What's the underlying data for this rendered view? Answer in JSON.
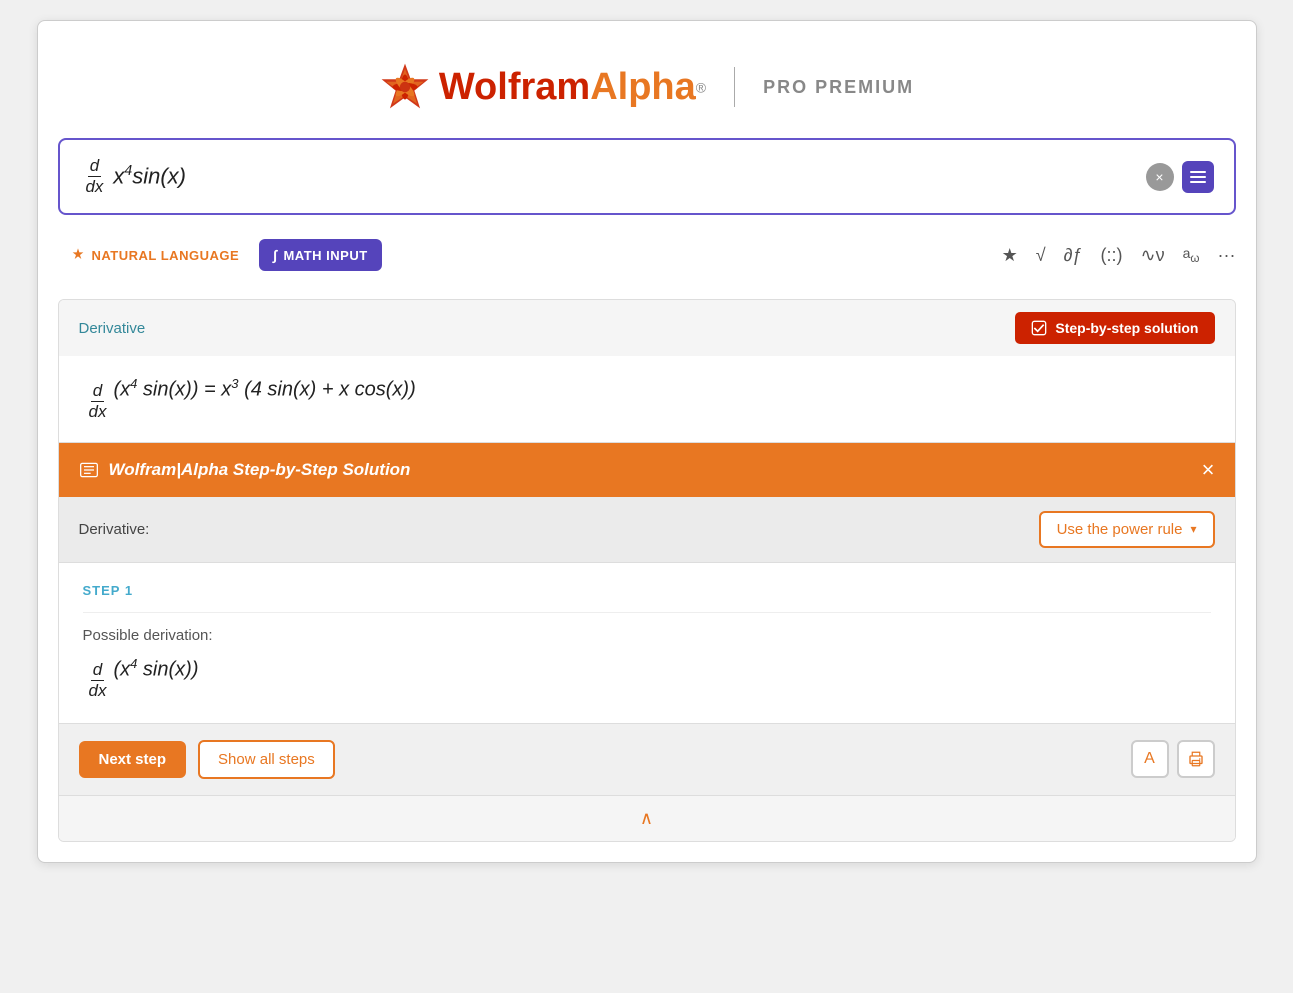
{
  "header": {
    "logo_wolfram": "Wolfram",
    "logo_alpha": "Alpha",
    "logo_reg": "®",
    "pro_premium": "PRO PREMIUM"
  },
  "search": {
    "formula_display": "d/dx x⁴sin(x)",
    "clear_btn_label": "×",
    "menu_btn_label": "≡"
  },
  "toolbar": {
    "natural_language_label": "Natural Language",
    "math_input_label": "Math Input",
    "icons": [
      "★",
      "√",
      "∂ƒ",
      "(::)",
      "∿ν",
      "aω",
      "···"
    ]
  },
  "result": {
    "title": "Derivative",
    "step_solution_label": "Step-by-step solution",
    "formula": "d/dx(x⁴ sin(x)) = x³(4 sin(x) + x cos(x))"
  },
  "step_panel": {
    "title": "Wolfram|Alpha Step-by-Step Solution",
    "close_label": "×",
    "derivative_label": "Derivative:",
    "power_rule_label": "Use the power rule",
    "step1_label": "STEP 1",
    "possible_derivation_label": "Possible derivation:",
    "step1_formula": "d/dx(x⁴ sin(x))",
    "next_step_label": "Next step",
    "show_all_steps_label": "Show all steps",
    "font_btn_label": "A",
    "print_btn_label": "🖨",
    "collapse_arrow": "∧"
  }
}
